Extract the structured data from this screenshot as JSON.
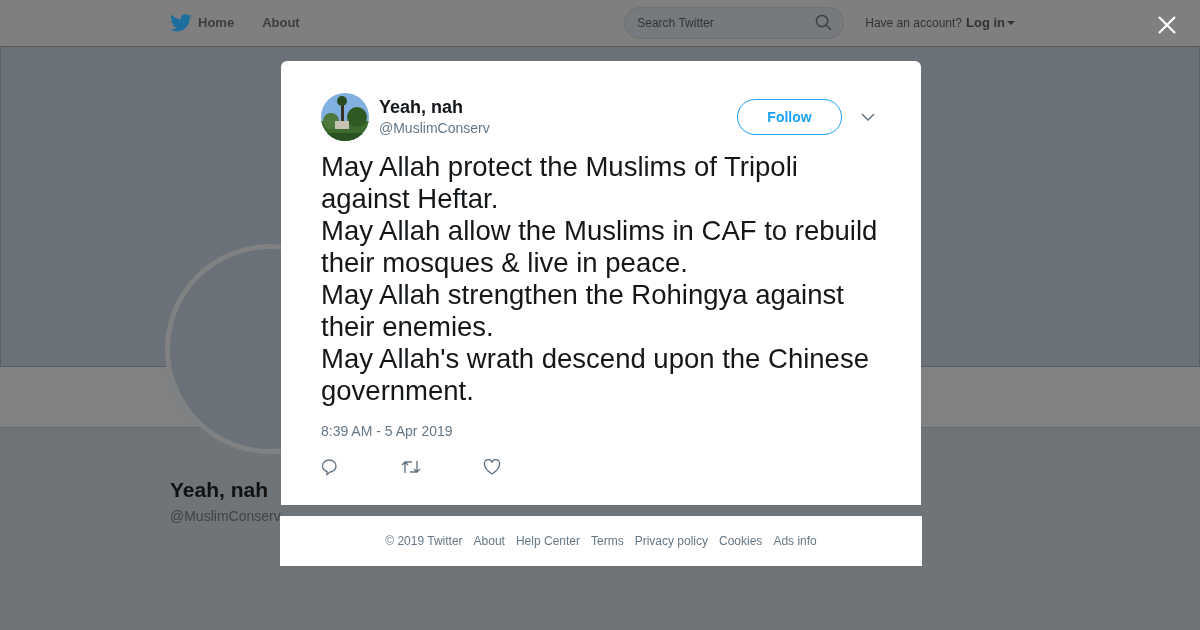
{
  "nav": {
    "links": [
      "Home",
      "About"
    ],
    "search": {
      "placeholder": "Search Twitter"
    },
    "account_prompt": "Have an account?",
    "login": "Log in"
  },
  "profile": {
    "name": "Yeah, nah",
    "handle": "@MuslimConserv"
  },
  "tweet": {
    "name": "Yeah, nah",
    "handle": "@MuslimConserv",
    "follow": "Follow",
    "lines": [
      "May Allah protect the Muslims of Tripoli against Heftar.",
      "May Allah allow the Muslims in CAF to rebuild their mosques & live in peace.",
      "May Allah strengthen the Rohingya against their enemies.",
      "May Allah's wrath descend upon the Chinese government."
    ],
    "time": "8:39 AM - 5 Apr 2019"
  },
  "footer": [
    "© 2019 Twitter",
    "About",
    "Help Center",
    "Terms",
    "Privacy policy",
    "Cookies",
    "Ads info"
  ]
}
